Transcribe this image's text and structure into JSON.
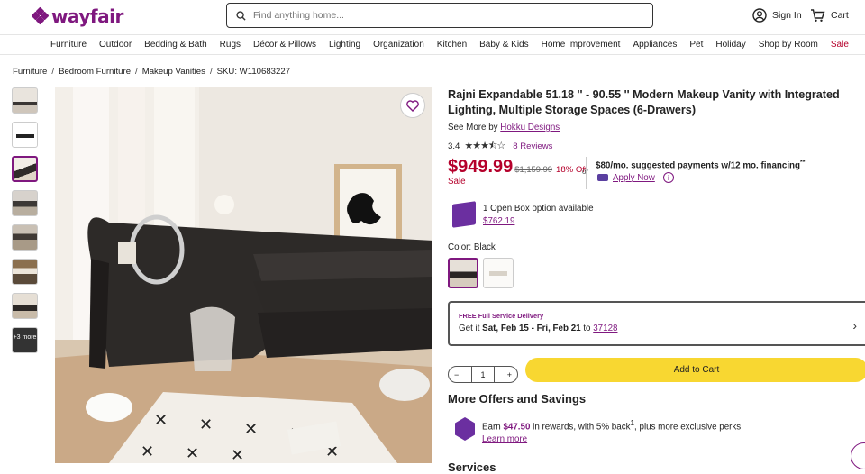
{
  "brand": {
    "name": "wayfair",
    "color": "#7f187f"
  },
  "header": {
    "search_placeholder": "Find anything home...",
    "sign_in": "Sign In",
    "cart": "Cart"
  },
  "nav": [
    "Furniture",
    "Outdoor",
    "Bedding & Bath",
    "Rugs",
    "Décor & Pillows",
    "Lighting",
    "Organization",
    "Kitchen",
    "Baby & Kids",
    "Home Improvement",
    "Appliances",
    "Pet",
    "Holiday",
    "Shop by Room",
    "Sale"
  ],
  "breadcrumb": [
    "Furniture",
    "Bedroom Furniture",
    "Makeup Vanities",
    "SKU: W110683227"
  ],
  "thumbnails": {
    "more_label": "+3 more"
  },
  "product": {
    "title": "Rajni Expandable 51.18 '' - 90.55 '' Modern Makeup Vanity with Integrated Lighting, Multiple Storage Spaces (6-Drawers)",
    "see_more": "See More by",
    "brand_link": "Hokku Designs",
    "rating": "3.4",
    "rating_value": 3.4,
    "reviews": "8 Reviews",
    "price": "$949.99",
    "was_price": "$1,159.99",
    "discount": "18% Off",
    "sale_label": "Sale",
    "or": "or",
    "financing": "$80/mo. suggested payments w/12 mo. financing",
    "financing_mark": "**",
    "apply_now": "Apply Now",
    "open_box_text": "1 Open Box option available",
    "open_box_price": "$762.19",
    "color_label": "Color:",
    "color_value": "Black",
    "delivery_badge": "FREE Full Service Delivery",
    "delivery_prefix": "Get it",
    "delivery_dates": "Sat, Feb 15 - Fri, Feb 21",
    "delivery_to": "to",
    "zip": "37128",
    "quantity": "1",
    "add_to_cart": "Add to Cart",
    "more_offers": "More Offers and Savings",
    "reward_prefix": "Earn",
    "reward_amount": "$47.50",
    "reward_suffix": "in rewards, with 5% back",
    "reward_sup": "1",
    "reward_tail": ", plus more exclusive perks",
    "learn_more": "Learn more",
    "services": "Services"
  },
  "colors": {
    "sale": "#b5002b",
    "accent": "#7f187f",
    "cart_button": "#f8d731"
  }
}
